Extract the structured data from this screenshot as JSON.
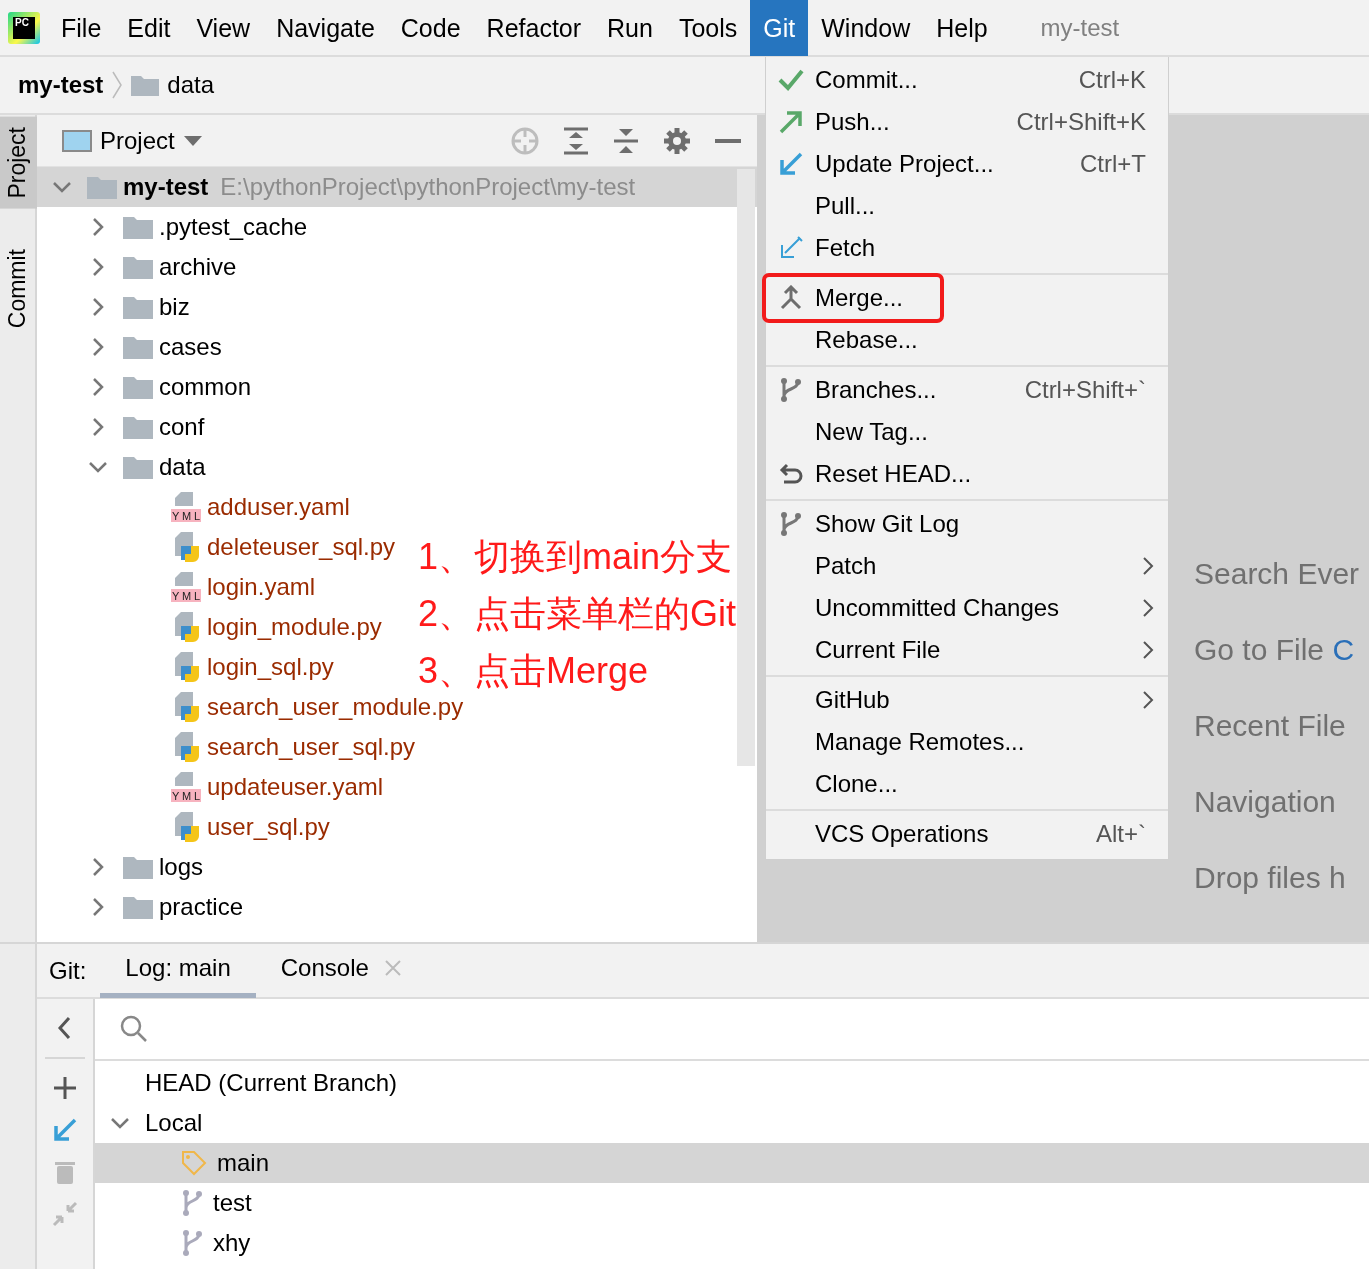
{
  "logo": {
    "text": "PC"
  },
  "menubar": [
    {
      "label": "File",
      "selected": false
    },
    {
      "label": "Edit",
      "selected": false
    },
    {
      "label": "View",
      "selected": false
    },
    {
      "label": "Navigate",
      "selected": false
    },
    {
      "label": "Code",
      "selected": false
    },
    {
      "label": "Refactor",
      "selected": false
    },
    {
      "label": "Run",
      "selected": false
    },
    {
      "label": "Tools",
      "selected": false
    },
    {
      "label": "Git",
      "selected": true
    },
    {
      "label": "Window",
      "selected": false
    },
    {
      "label": "Help",
      "selected": false
    }
  ],
  "window": {
    "title": "my-test"
  },
  "breadcrumb": [
    "my-test",
    "data"
  ],
  "side_tabs": [
    {
      "label": "Project",
      "selected": true
    },
    {
      "label": "Commit",
      "selected": false
    }
  ],
  "project_panel": {
    "title": "Project",
    "tree": [
      {
        "name": "my-test",
        "path": "E:\\pythonProject\\pythonProject\\my-test",
        "kind": "folder",
        "expanded": true,
        "selected": true,
        "children": [
          {
            "name": ".pytest_cache",
            "kind": "folder",
            "expanded": false
          },
          {
            "name": "archive",
            "kind": "folder",
            "expanded": false
          },
          {
            "name": "biz",
            "kind": "folder",
            "expanded": false
          },
          {
            "name": "cases",
            "kind": "folder",
            "expanded": false
          },
          {
            "name": "common",
            "kind": "folder",
            "expanded": false
          },
          {
            "name": "conf",
            "kind": "folder",
            "expanded": false
          },
          {
            "name": "data",
            "kind": "folder",
            "expanded": true,
            "children": [
              {
                "name": "adduser.yaml",
                "kind": "yaml",
                "badge": "YML"
              },
              {
                "name": "deleteuser_sql.py",
                "kind": "python"
              },
              {
                "name": "login.yaml",
                "kind": "yaml",
                "badge": "YML"
              },
              {
                "name": "login_module.py",
                "kind": "python"
              },
              {
                "name": "login_sql.py",
                "kind": "python"
              },
              {
                "name": "search_user_module.py",
                "kind": "python"
              },
              {
                "name": "search_user_sql.py",
                "kind": "python"
              },
              {
                "name": "updateuser.yaml",
                "kind": "yaml",
                "badge": "YML"
              },
              {
                "name": "user_sql.py",
                "kind": "python"
              }
            ]
          },
          {
            "name": "logs",
            "kind": "folder",
            "expanded": false
          },
          {
            "name": "practice",
            "kind": "folder",
            "expanded": false
          }
        ]
      }
    ]
  },
  "annotations": [
    "1、切换到main分支",
    "2、点击菜单栏的Git",
    "3、点击Merge"
  ],
  "git_menu": [
    [
      {
        "label": "Commit...",
        "shortcut": "Ctrl+K"
      },
      {
        "label": "Push...",
        "shortcut": "Ctrl+Shift+K"
      },
      {
        "label": "Update Project...",
        "shortcut": "Ctrl+T"
      },
      {
        "label": "Pull..."
      },
      {
        "label": "Fetch"
      }
    ],
    [
      {
        "label": "Merge...",
        "highlighted": true
      },
      {
        "label": "Rebase...",
        "highlighted": false
      }
    ],
    [
      {
        "label": "Branches...",
        "shortcut": "Ctrl+Shift+`"
      },
      {
        "label": "New Tag..."
      },
      {
        "label": "Reset HEAD..."
      }
    ],
    [
      {
        "label": "Show Git Log"
      },
      {
        "label": "Patch",
        "submenu": true
      },
      {
        "label": "Uncommitted Changes",
        "submenu": true
      },
      {
        "label": "Current File",
        "submenu": true
      }
    ],
    [
      {
        "label": "GitHub",
        "submenu": true
      },
      {
        "label": "Manage Remotes..."
      },
      {
        "label": "Clone..."
      }
    ],
    [
      {
        "label": "VCS Operations",
        "shortcut": "Alt+`"
      }
    ]
  ],
  "editor_hints": [
    {
      "label": "Search Ever"
    },
    {
      "label": "Go to File",
      "shortcut": "C"
    },
    {
      "label": "Recent File"
    },
    {
      "label": "Navigation"
    },
    {
      "label": "Drop files h"
    }
  ],
  "git_panel": {
    "label": "Git:",
    "tabs": [
      {
        "label": "Log: main",
        "selected": true,
        "closable": false
      },
      {
        "label": "Console",
        "selected": false,
        "closable": true
      }
    ],
    "branches": [
      {
        "name": "HEAD (Current Branch)",
        "kind": "head"
      },
      {
        "name": "Local",
        "kind": "group",
        "expanded": true,
        "children": [
          {
            "name": "main",
            "kind": "current",
            "selected": true
          },
          {
            "name": "test",
            "kind": "branch",
            "selected": false
          },
          {
            "name": "xhy",
            "kind": "branch",
            "selected": false
          }
        ]
      }
    ]
  }
}
